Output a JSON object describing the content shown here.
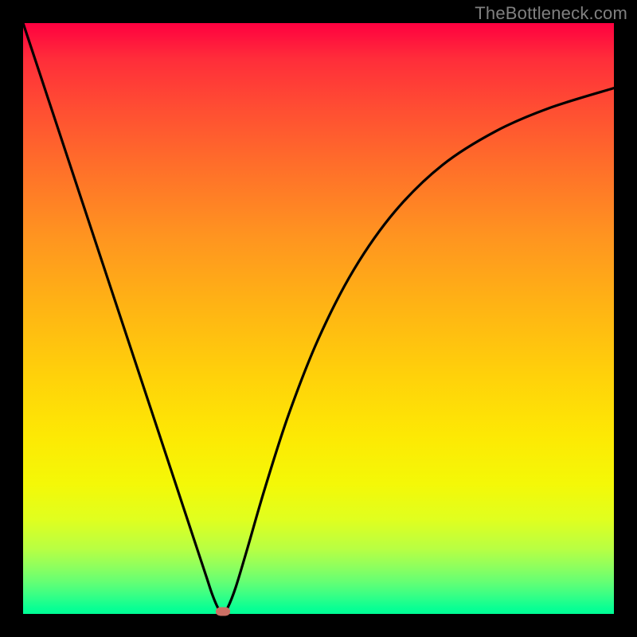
{
  "watermark": "TheBottleneck.com",
  "chart_data": {
    "type": "line",
    "title": "",
    "xlabel": "",
    "ylabel": "",
    "xlim": [
      0,
      100
    ],
    "ylim": [
      0,
      100
    ],
    "grid": false,
    "series": [
      {
        "name": "curve",
        "x": [
          0,
          5,
          10,
          15,
          20,
          25,
          29,
          31,
          32,
          33,
          33.8,
          34.6,
          36,
          38,
          41,
          45,
          50,
          56,
          63,
          71,
          80,
          89,
          100
        ],
        "values": [
          100,
          84.9,
          69.8,
          54.7,
          39.6,
          24.5,
          12.4,
          6.36,
          3.34,
          0.99,
          0.1,
          0.99,
          4.54,
          11.2,
          21.5,
          33.9,
          46.6,
          58.3,
          68.2,
          76.0,
          81.7,
          85.6,
          89.0
        ]
      }
    ],
    "marker": {
      "x_pct": 33.8,
      "y_pct": 0.4,
      "color": "#cc6f64"
    },
    "background_gradient": {
      "top": "#ff0040",
      "bottom": "#00ff96"
    }
  }
}
